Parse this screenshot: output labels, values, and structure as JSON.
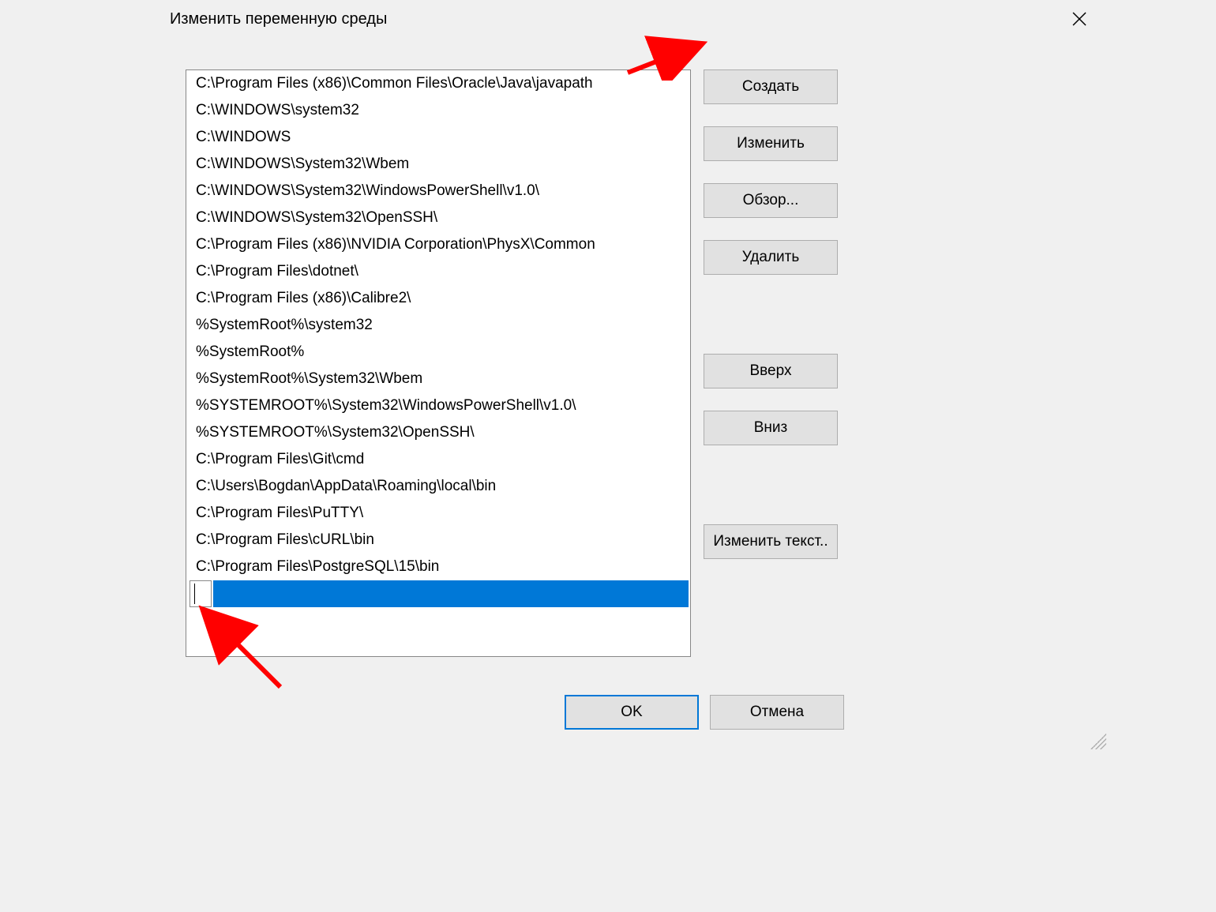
{
  "dialog": {
    "title": "Изменить переменную среды"
  },
  "path_entries": [
    "C:\\Program Files (x86)\\Common Files\\Oracle\\Java\\javapath",
    "C:\\WINDOWS\\system32",
    "C:\\WINDOWS",
    "C:\\WINDOWS\\System32\\Wbem",
    "C:\\WINDOWS\\System32\\WindowsPowerShell\\v1.0\\",
    "C:\\WINDOWS\\System32\\OpenSSH\\",
    "C:\\Program Files (x86)\\NVIDIA Corporation\\PhysX\\Common",
    "C:\\Program Files\\dotnet\\",
    "C:\\Program Files (x86)\\Calibre2\\",
    "%SystemRoot%\\system32",
    "%SystemRoot%",
    "%SystemRoot%\\System32\\Wbem",
    "%SYSTEMROOT%\\System32\\WindowsPowerShell\\v1.0\\",
    "%SYSTEMROOT%\\System32\\OpenSSH\\",
    "C:\\Program Files\\Git\\cmd",
    "C:\\Users\\Bogdan\\AppData\\Roaming\\local\\bin",
    "C:\\Program Files\\PuTTY\\",
    "C:\\Program Files\\cURL\\bin",
    "C:\\Program Files\\PostgreSQL\\15\\bin"
  ],
  "new_entry_value": "",
  "buttons": {
    "new": "Создать",
    "edit": "Изменить",
    "browse": "Обзор...",
    "delete": "Удалить",
    "up": "Вверх",
    "down": "Вниз",
    "edit_text": "Изменить текст..",
    "ok": "OK",
    "cancel": "Отмена"
  },
  "annotations": {
    "arrow_color": "#ff0000"
  }
}
